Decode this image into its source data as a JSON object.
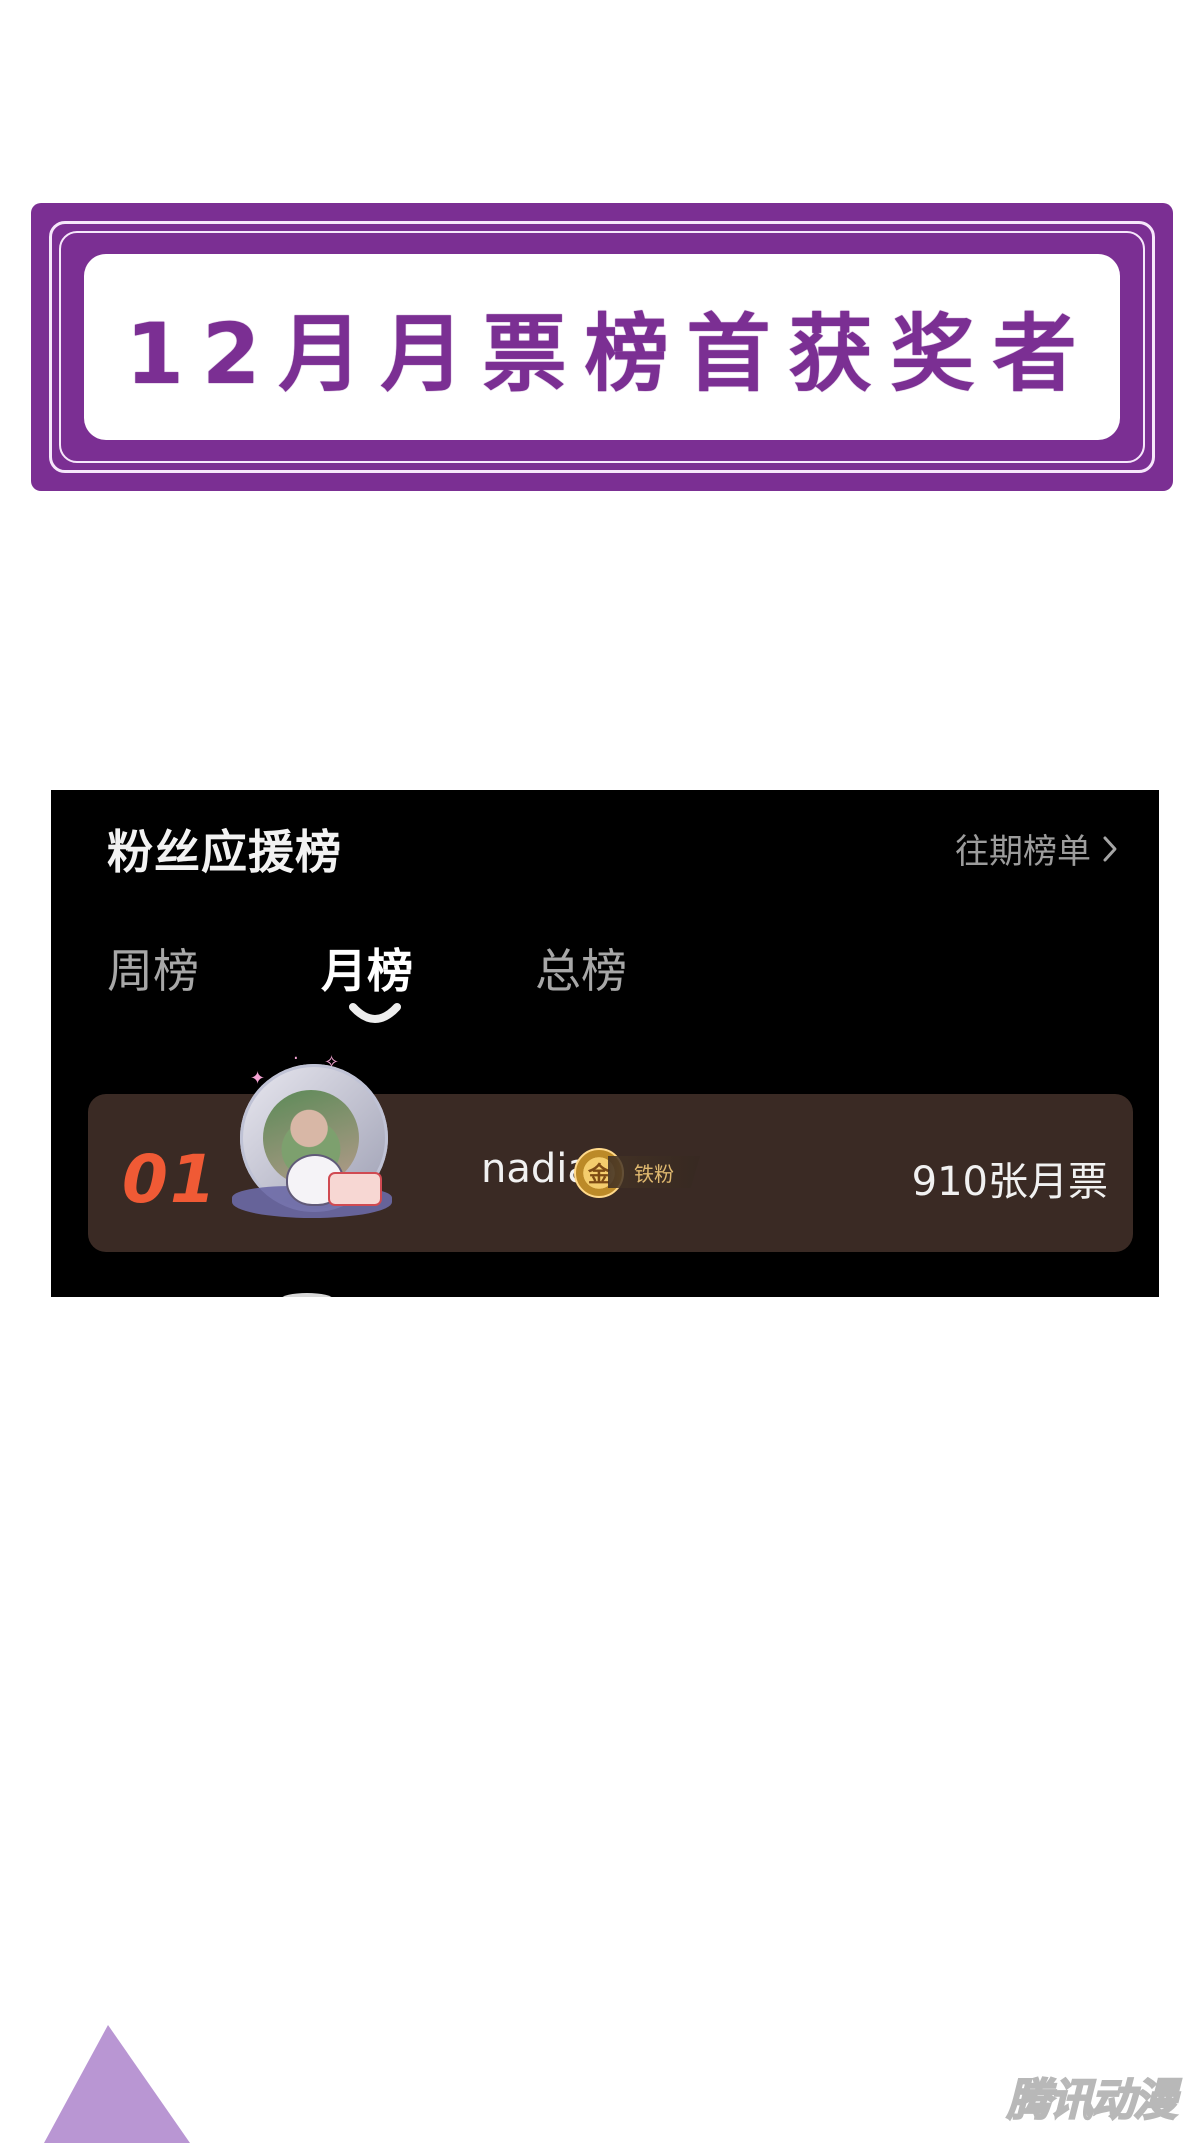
{
  "banner": {
    "title": "12月月票榜首获奖者",
    "accent_color": "#7b2f93"
  },
  "screen": {
    "title": "粉丝应援榜",
    "history_label": "往期榜单",
    "history_icon": "chevron-right-icon",
    "tabs": [
      {
        "label": "周榜",
        "selected": false
      },
      {
        "label": "月榜",
        "selected": true
      },
      {
        "label": "总榜",
        "selected": false
      }
    ],
    "ranking": [
      {
        "rank": "01",
        "username": "nadia",
        "badge_symbol": "金",
        "badge_label": "铁粉",
        "tickets": "910张月票",
        "avatar_icon": "profile-avatar",
        "rank_color": "#f05a35",
        "row_color": "#3a2a24"
      }
    ]
  },
  "footer": {
    "watermark": "腾讯动漫",
    "decoration_color": "#b996d3"
  }
}
